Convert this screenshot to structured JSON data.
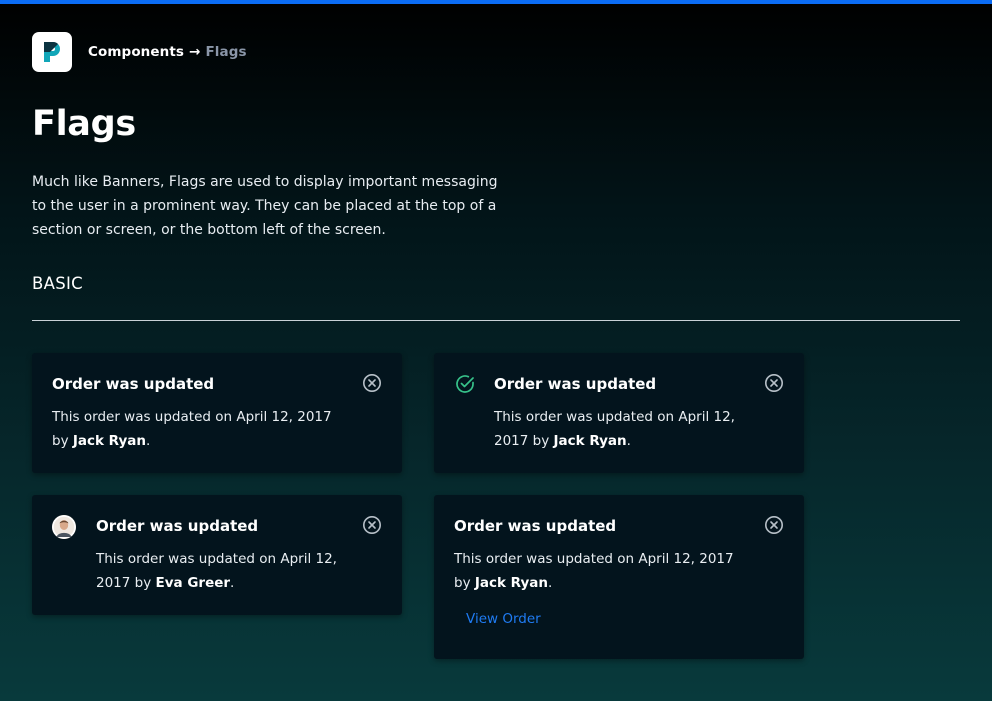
{
  "colors": {
    "accent_bar": "#0b6cf5",
    "link": "#1f7bf2",
    "success": "#37c28a",
    "card_bg": "#03141d",
    "breadcrumb_current": "#8a96a8"
  },
  "header": {
    "logo_icon": "p-logo-icon",
    "breadcrumb": {
      "root": "Components",
      "separator": "→",
      "current": "Flags"
    }
  },
  "page": {
    "title": "Flags",
    "description": "Much like Banners, Flags are used to display important messaging to the user in a prominent way. They can be placed at the top of a section or screen, or the bottom left of the screen.",
    "section_title": "BASIC"
  },
  "flags": [
    {
      "title": "Order was updated",
      "body_prefix": "This order was updated on April 12, 2017 by ",
      "person": "Jack Ryan",
      "body_suffix": ".",
      "close_icon": "close-circle-icon"
    },
    {
      "title": "Order was updated",
      "body_prefix": "This order was updated on April 12, 2017 by ",
      "person": "Jack Ryan",
      "body_suffix": ".",
      "lead_icon": "check-circle-icon",
      "close_icon": "close-circle-icon"
    },
    {
      "title": "Order was updated",
      "body_prefix": "This order was updated on April 12, 2017 by ",
      "person": "Eva Greer",
      "body_suffix": ".",
      "lead_icon": "avatar",
      "close_icon": "close-circle-icon"
    },
    {
      "title": "Order was updated",
      "body_prefix": "This order was updated on April 12, 2017 by ",
      "person": "Jack Ryan",
      "body_suffix": ".",
      "action_label": "View Order",
      "close_icon": "close-circle-icon"
    }
  ]
}
